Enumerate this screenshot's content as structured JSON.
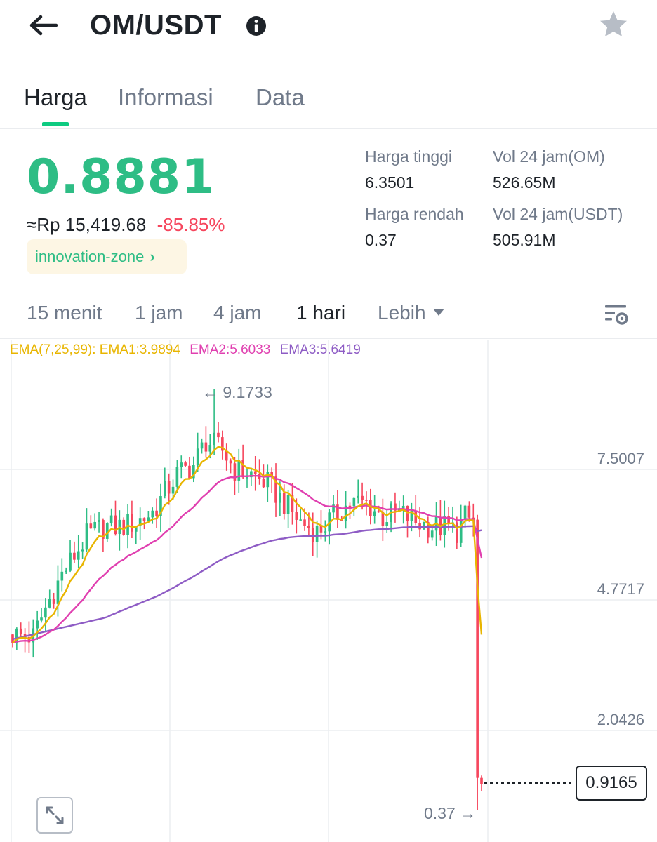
{
  "header": {
    "pair": "OM/USDT",
    "back_icon": "arrow-left-icon",
    "info_icon": "info-icon",
    "favorite_icon": "star-icon"
  },
  "tabs": [
    {
      "label": "Harga",
      "active": true
    },
    {
      "label": "Informasi",
      "active": false
    },
    {
      "label": "Data",
      "active": false
    }
  ],
  "price": {
    "last": "0.8881",
    "fiat": "≈Rp 15,419.68",
    "change": "-85.85%",
    "zone": "innovation-zone",
    "zone_chevron": "›"
  },
  "stats": {
    "high_label": "Harga tinggi",
    "high_value": "6.3501",
    "low_label": "Harga rendah",
    "low_value": "0.37",
    "vol_base_label": "Vol 24 jam(OM)",
    "vol_base_value": "526.65M",
    "vol_quote_label": "Vol 24 jam(USDT)",
    "vol_quote_value": "505.91M"
  },
  "intervals": [
    {
      "label": "15 menit",
      "active": false
    },
    {
      "label": "1 jam",
      "active": false
    },
    {
      "label": "4 jam",
      "active": false
    },
    {
      "label": "1 hari",
      "active": true
    },
    {
      "label": "Lebih",
      "active": false
    }
  ],
  "ema_legend": {
    "ema1": "EMA(7,25,99): EMA1:3.9894",
    "ema2": "EMA2:5.6033",
    "ema3": "EMA3:5.6419"
  },
  "colors": {
    "up": "#2ebd85",
    "down": "#f6465d",
    "ema1": "#e8b500",
    "ema2": "#e040b0",
    "ema3": "#8e5cc5",
    "grid": "#eceef1"
  },
  "chart_data": {
    "type": "candlestick",
    "y_ticks": [
      "7.5007",
      "4.7717",
      "2.0426"
    ],
    "y_tick_values": [
      7.5007,
      4.7717,
      2.0426
    ],
    "high_marker": "← 9.1733",
    "low_marker": "0.37 →",
    "last_price": "0.9165",
    "y_range": [
      0.37,
      9.1733
    ]
  }
}
